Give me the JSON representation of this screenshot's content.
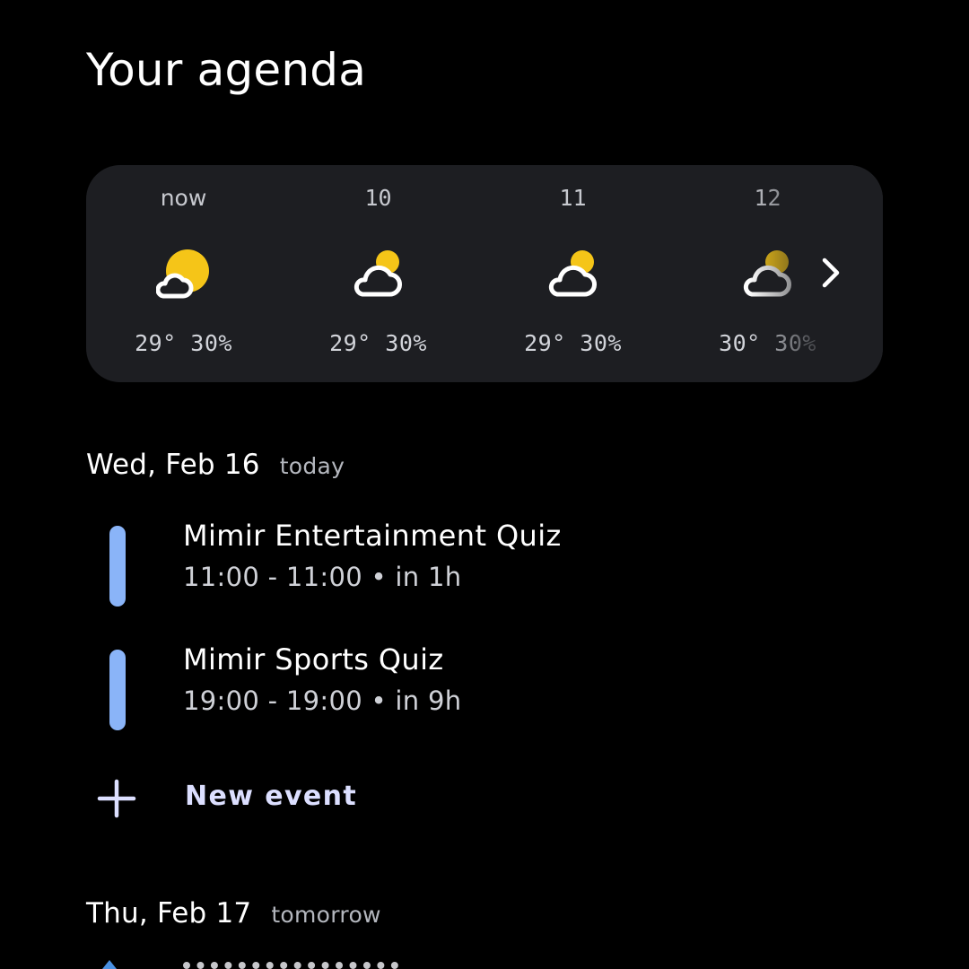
{
  "page": {
    "title": "Your agenda"
  },
  "weather": {
    "hours": [
      {
        "label": "now",
        "temp": "29°",
        "precip": "30%",
        "icon": "sun-behind-cloud-icon"
      },
      {
        "label": "10",
        "temp": "29°",
        "precip": "30%",
        "icon": "cloud-with-sun-icon"
      },
      {
        "label": "11",
        "temp": "29°",
        "precip": "30%",
        "icon": "cloud-with-sun-icon"
      },
      {
        "label": "12",
        "temp": "30°",
        "precip": "30%",
        "icon": "cloud-with-sun-icon"
      }
    ],
    "next_icon": "chevron-right-icon"
  },
  "days": [
    {
      "date": "Wed, Feb 16",
      "relative": "today",
      "events": [
        {
          "title": "Mimir Entertainment Quiz",
          "time": "11:00 - 11:00 • in 1h",
          "color": "#8ab4f8"
        },
        {
          "title": "Mimir Sports Quiz",
          "time": "19:00 - 19:00 • in 9h",
          "color": "#8ab4f8"
        }
      ],
      "new_event_label": "New event"
    },
    {
      "date": "Thu, Feb 17",
      "relative": "tomorrow"
    }
  ],
  "colors": {
    "background": "#000000",
    "card": "#1d1e22",
    "sun": "#f5c518",
    "accent": "#8ab4f8",
    "new_event": "#dcdfff"
  }
}
